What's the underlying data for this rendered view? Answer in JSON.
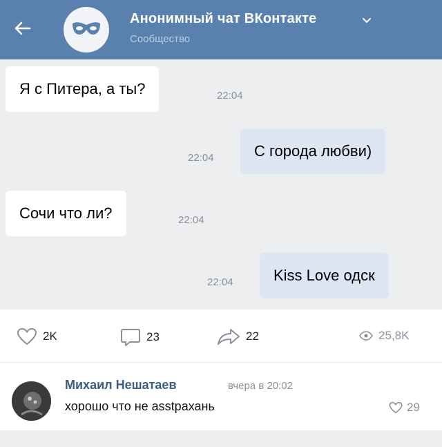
{
  "header": {
    "title": "Анонимный чат ВКонтакте",
    "subtitle": "Сообщество",
    "back_icon": "arrow-left-icon",
    "avatar_icon": "mask-icon"
  },
  "messages": [
    {
      "direction": "incoming",
      "text": "Я с Питера, а ты?",
      "time": "22:04"
    },
    {
      "direction": "outgoing",
      "text": "С города любви)",
      "time": "22:04"
    },
    {
      "direction": "incoming",
      "text": "Сочи что ли?",
      "time": "22:04"
    },
    {
      "direction": "outgoing",
      "text": "Kiss Love одск",
      "time": "22:04"
    }
  ],
  "stats": {
    "likes": "2K",
    "comments": "23",
    "shares": "22",
    "views": "25,8K"
  },
  "comment": {
    "author": "Михаил Нешатаев",
    "date": "вчера в 20:02",
    "text": "хорошо что не asstрахань",
    "likes": "29"
  },
  "colors": {
    "header_bg": "#5a80ae",
    "chat_bg": "#edeef0",
    "outgoing_bubble": "#dde6f2",
    "author_name": "#3d5c84"
  }
}
